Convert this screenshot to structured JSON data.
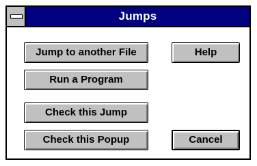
{
  "window": {
    "title": "Jumps"
  },
  "buttons": {
    "jump_to_file": "Jump to another File",
    "run_program": "Run a Program",
    "check_jump": "Check this Jump",
    "check_popup": "Check this Popup",
    "help": "Help",
    "cancel": "Cancel"
  },
  "colors": {
    "titlebar": "#000080",
    "button_face": "#c0c0c0",
    "dialog_background": "#ffffff"
  }
}
